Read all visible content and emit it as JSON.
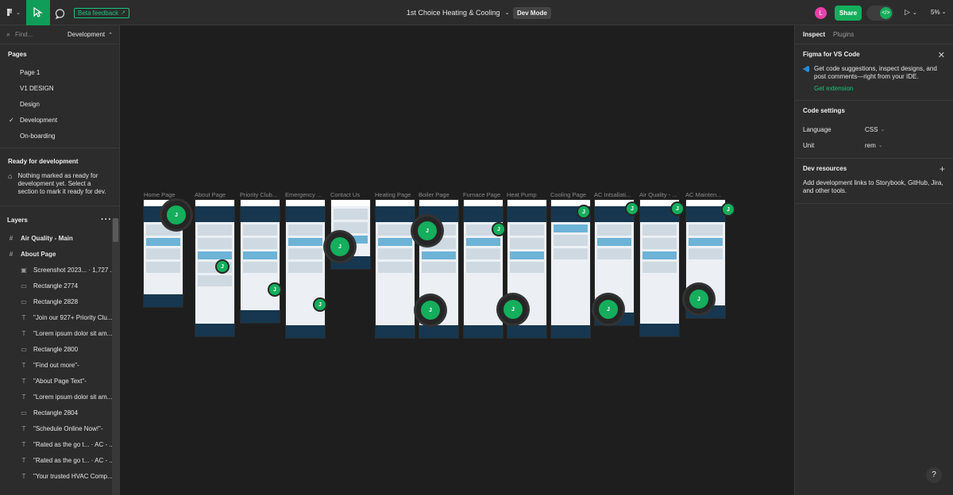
{
  "toolbar": {
    "beta_label": "Beta feedback",
    "file_title": "1st Choice Heating & Cooling",
    "mode_badge": "Dev Mode",
    "avatar_letter": "L",
    "share_label": "Share",
    "zoom": "5%"
  },
  "left": {
    "find_placeholder": "Find...",
    "current_page": "Development",
    "pages_title": "Pages",
    "pages": [
      "Page 1",
      "V1 DESIGN",
      "Design",
      "Development",
      "On-boarding"
    ],
    "ready_title": "Ready for development",
    "ready_message": "Nothing marked as ready for development yet. Select a section to mark it ready for dev.",
    "layers_title": "Layers",
    "layers": [
      {
        "icon": "frame",
        "label": "Air Quality - Main",
        "level": 0
      },
      {
        "icon": "frame",
        "label": "About Page",
        "level": 0
      },
      {
        "icon": "image",
        "label": "Screenshot 2023... · 1,727 ...",
        "level": 1
      },
      {
        "icon": "rect",
        "label": "Rectangle 2774",
        "level": 1
      },
      {
        "icon": "rect",
        "label": "Rectangle 2828",
        "level": 1
      },
      {
        "icon": "text",
        "label": "\"Join our 927+ Priority Clu...",
        "level": 1
      },
      {
        "icon": "text",
        "label": "\"Lorem ipsum dolor sit am...",
        "level": 1
      },
      {
        "icon": "rect",
        "label": "Rectangle 2800",
        "level": 1
      },
      {
        "icon": "text",
        "label": "\"Find out more\"-",
        "level": 1
      },
      {
        "icon": "text",
        "label": "\"About Page Text\"-",
        "level": 1
      },
      {
        "icon": "text",
        "label": "\"Lorem ipsum dolor sit am...",
        "level": 1
      },
      {
        "icon": "rect",
        "label": "Rectangle 2804",
        "level": 1
      },
      {
        "icon": "text",
        "label": "\"Schedule Online Now!\"-",
        "level": 1
      },
      {
        "icon": "text",
        "label": "\"Rated as the go t... · AC - ...",
        "level": 1
      },
      {
        "icon": "text",
        "label": "\"Rated as the go t... · AC - ...",
        "level": 1
      },
      {
        "icon": "text",
        "label": "\"Your trusted HVAC Comp...",
        "level": 1
      }
    ]
  },
  "canvas": {
    "frames": [
      "Home Page",
      "About Page",
      "Priority Club...",
      "Emergency ...",
      "Contact Us",
      "Heating Page",
      "Boiler Page",
      "Furnace Page",
      "Heat Pump",
      "Cooling Page",
      "AC Intsallati...",
      "Air Quality - ...",
      "AC Mainten..."
    ],
    "cursor_letter": "J"
  },
  "right": {
    "tabs": [
      "Inspect",
      "Plugins"
    ],
    "vscode_title": "Figma for VS Code",
    "vscode_text": "Get code suggestions, inspect designs, and post comments—right from your IDE.",
    "vscode_link": "Get extension",
    "code_settings_title": "Code settings",
    "language_label": "Language",
    "language_value": "CSS",
    "unit_label": "Unit",
    "unit_value": "rem",
    "dev_resources_title": "Dev resources",
    "dev_resources_text": "Add development links to Storybook, GitHub, Jira, and other tools."
  },
  "help_label": "?",
  "colors": {
    "accent": "#14ae5c",
    "panel": "#2c2c2c",
    "canvas": "#1e1e1e"
  }
}
